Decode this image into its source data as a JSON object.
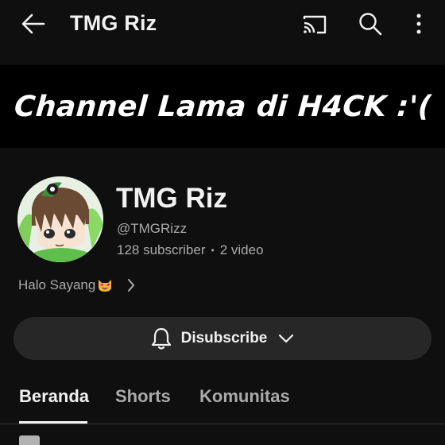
{
  "header": {
    "title": "TMG Riz",
    "back_icon": "arrow-left-icon",
    "cast_icon": "cast-icon",
    "search_icon": "search-icon",
    "more_icon": "more-vert-icon"
  },
  "banner": {
    "text": "Channel Lama di H4CK :'("
  },
  "channel": {
    "name": "TMG Riz",
    "handle": "@TMGRizz",
    "subscribers": "128 subscriber",
    "separator": "•",
    "videos": "2 video",
    "description": "Halo Sayang"
  },
  "subscribe": {
    "label": "Disubscribe"
  },
  "tabs": [
    {
      "label": "Beranda",
      "active": true
    },
    {
      "label": "Shorts",
      "active": false
    },
    {
      "label": "Komunitas",
      "active": false
    }
  ],
  "colors": {
    "background": "#0f0f0f",
    "button": "#272727",
    "secondary_text": "#aaaaaa"
  }
}
